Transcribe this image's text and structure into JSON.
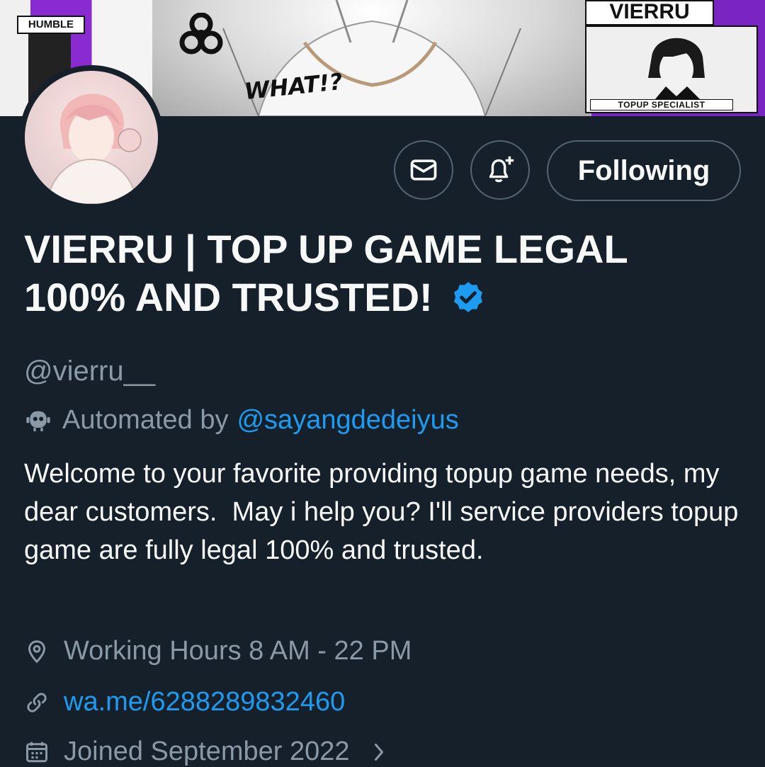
{
  "banner": {
    "humble_label": "HUMBLE",
    "brand_label": "VIERRU",
    "exclaim_label": "WHAT!?",
    "tagline_label": "TOPUP    SPECIALIST"
  },
  "actions": {
    "follow_label": "Following"
  },
  "profile": {
    "display_name": "VIERRU | TOP UP GAME LEGAL 100% AND TRUSTED!",
    "handle": "@vierru__",
    "automated_prefix": "Automated by",
    "automated_account": "@sayangdedeiyus",
    "bio": "Welcome to your favorite providing topup game needs, my dear customers.  May i help you? I'll service providers topup game are fully legal 100% and trusted.",
    "location": "Working Hours 8 AM - 22 PM",
    "website": "wa.me/6288289832460",
    "joined": "Joined September 2022"
  },
  "colors": {
    "background": "#15202b",
    "text_primary": "#f7f9f9",
    "text_secondary": "#8b98a5",
    "link": "#1d9bf0",
    "border": "#536471"
  },
  "icons": [
    "message-icon",
    "bell-plus-icon",
    "verified-badge-icon",
    "bot-icon",
    "location-pin-icon",
    "link-icon",
    "calendar-icon",
    "chevron-right-icon"
  ]
}
